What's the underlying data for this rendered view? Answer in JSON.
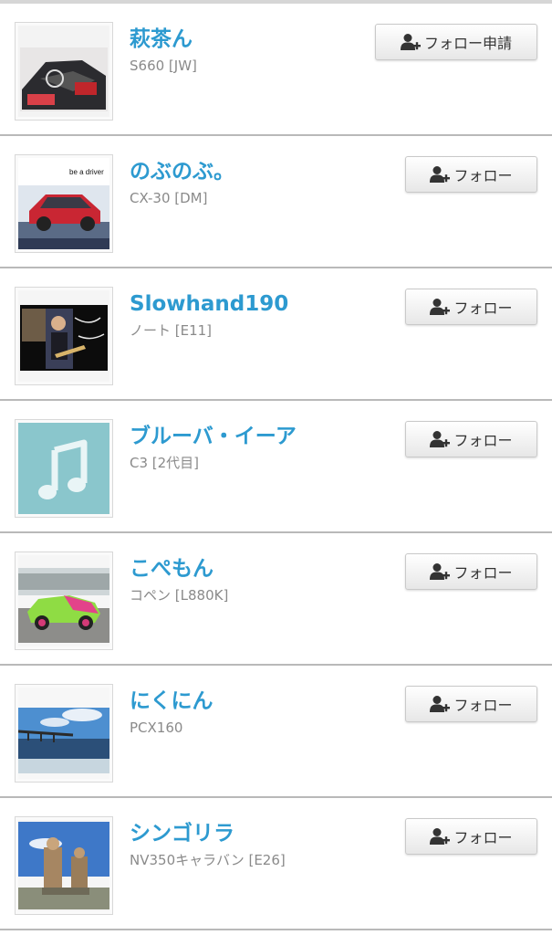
{
  "follow_list": {
    "items": [
      {
        "name": "萩茶ん",
        "car": "S660 [JW]",
        "button_label": "フォロー申請",
        "thumb_icon": "car-interior-photo"
      },
      {
        "name": "のぶのぶ。",
        "car": "CX-30 [DM]",
        "button_label": "フォロー",
        "thumb_icon": "red-suv-photo",
        "thumb_text": "be a driver"
      },
      {
        "name": "Slowhand190",
        "car": "ノート [E11]",
        "button_label": "フォロー",
        "thumb_icon": "guitarist-collage-photo"
      },
      {
        "name": "ブルーバ・イーア",
        "car": "C3 [2代目]",
        "button_label": "フォロー",
        "thumb_icon": "music-note-icon"
      },
      {
        "name": "こぺもん",
        "car": "コペン [L880K]",
        "button_label": "フォロー",
        "thumb_icon": "green-pink-car-photo"
      },
      {
        "name": "にくにん",
        "car": "PCX160",
        "button_label": "フォロー",
        "thumb_icon": "bridge-sea-photo"
      },
      {
        "name": "シンゴリラ",
        "car": "NV350キャラバン [E26]",
        "button_label": "フォロー",
        "thumb_icon": "statues-photo"
      }
    ]
  },
  "colors": {
    "name_link": "#2d9ad0",
    "sub_text": "#8a8a8a",
    "divider": "#b9b9b9",
    "music_tile": "#8ac6cc"
  }
}
